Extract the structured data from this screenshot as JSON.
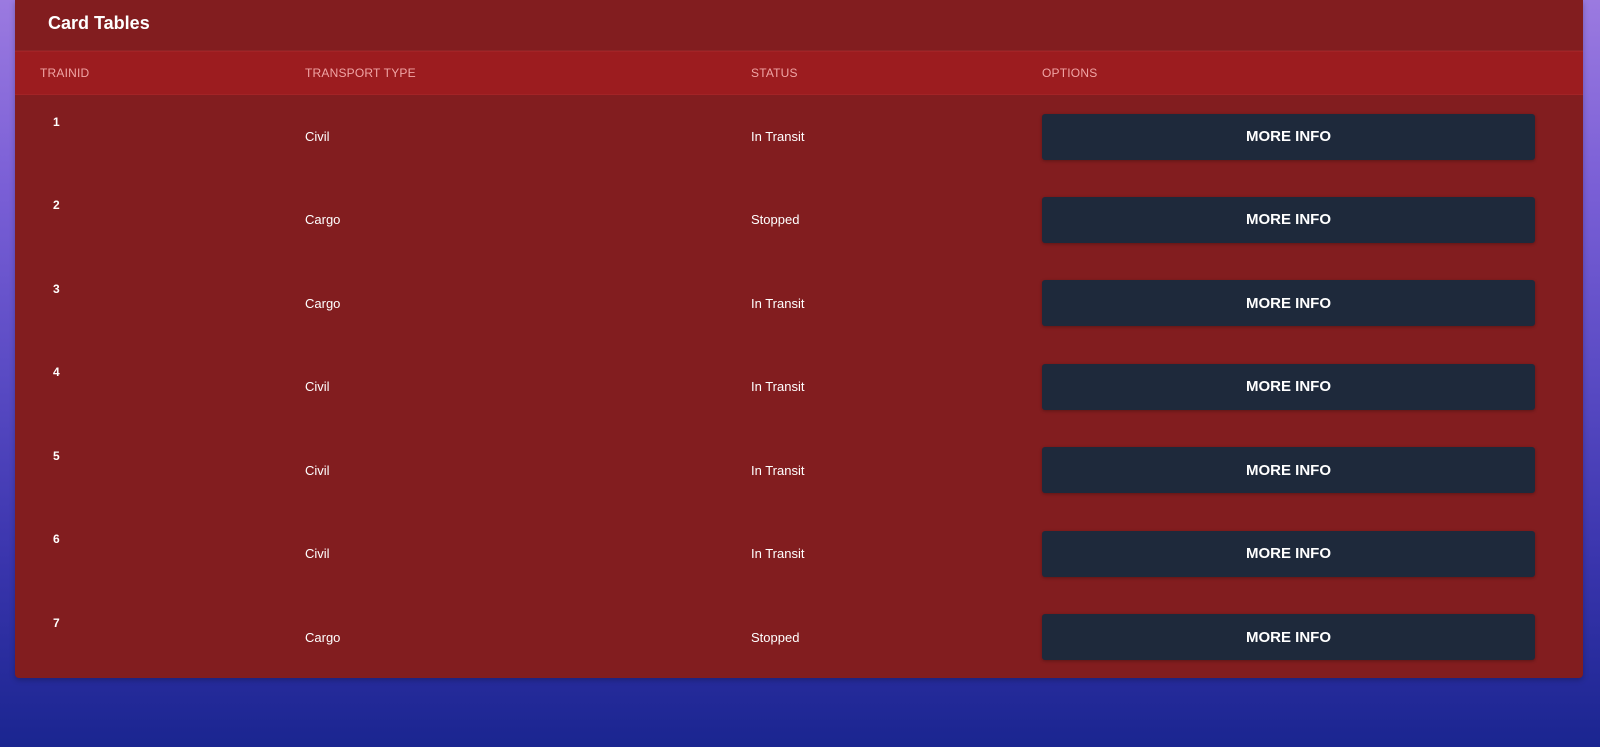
{
  "card": {
    "title": "Card Tables"
  },
  "table": {
    "headers": [
      "TRAINID",
      "TRANSPORT TYPE",
      "STATUS",
      "OPTIONS"
    ],
    "rows": [
      {
        "id": "1",
        "type": "Civil",
        "status": "In Transit",
        "action": "MORE INFO"
      },
      {
        "id": "2",
        "type": "Cargo",
        "status": "Stopped",
        "action": "MORE INFO"
      },
      {
        "id": "3",
        "type": "Cargo",
        "status": "In Transit",
        "action": "MORE INFO"
      },
      {
        "id": "4",
        "type": "Civil",
        "status": "In Transit",
        "action": "MORE INFO"
      },
      {
        "id": "5",
        "type": "Civil",
        "status": "In Transit",
        "action": "MORE INFO"
      },
      {
        "id": "6",
        "type": "Civil",
        "status": "In Transit",
        "action": "MORE INFO"
      },
      {
        "id": "7",
        "type": "Cargo",
        "status": "Stopped",
        "action": "MORE INFO"
      }
    ]
  },
  "colors": {
    "card_background": "#821d1f",
    "header_row_background": "#9c1c1f",
    "header_text": "#f0a5a5",
    "button_background": "#1e293b",
    "button_text": "#ffffff"
  }
}
